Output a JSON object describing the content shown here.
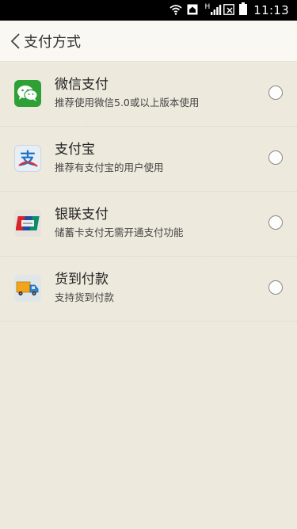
{
  "status_bar": {
    "time": "11:13",
    "network_label": "H",
    "icons": [
      "wifi-icon",
      "home-icon",
      "signal-icon",
      "sim-icon",
      "battery-icon"
    ]
  },
  "header": {
    "back_icon": "chevron-left-icon",
    "title": "支付方式"
  },
  "payment_methods": [
    {
      "title": "微信支付",
      "subtitle": "推荐使用微信5.0或以上版本使用",
      "icon": "wechat-icon"
    },
    {
      "title": "支付宝",
      "subtitle": "推荐有支付宝的用户使用",
      "icon": "alipay-icon"
    },
    {
      "title": "银联支付",
      "subtitle": "储蓄卡支付无需开通支付功能",
      "icon": "unionpay-icon"
    },
    {
      "title": "货到付款",
      "subtitle": "支持货到付款",
      "icon": "delivery-truck-icon"
    }
  ],
  "colors": {
    "background": "#ede9dd",
    "header_background": "#f9f8f3",
    "wechat_green": "#2fa036"
  }
}
